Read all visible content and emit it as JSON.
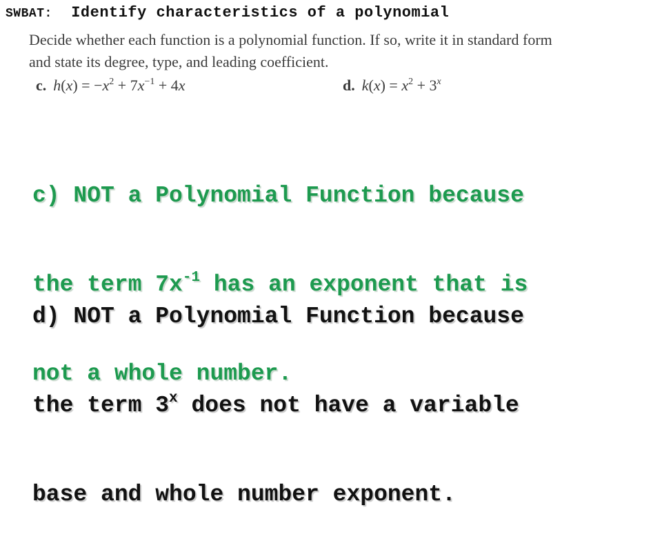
{
  "header": {
    "label": "SWBAT:",
    "objective": "Identify characteristics of a polynomial"
  },
  "problem": {
    "instruction_line1": "Decide whether each function is a polynomial function. If so, write it in standard form",
    "instruction_line2": "and state its degree, type, and leading coefficient.",
    "items": [
      {
        "letter": "c.",
        "fn": "h",
        "var": "x",
        "rhs_parts": [
          "−",
          "x",
          "2",
          " + 7",
          "x",
          "−1",
          " + 4",
          "x"
        ]
      },
      {
        "letter": "d.",
        "fn": "k",
        "var": "x",
        "rhs_parts": [
          "x",
          "2",
          " + 3",
          "x"
        ]
      }
    ]
  },
  "answers": {
    "c": {
      "line1": "c) NOT a Polynomial Function because",
      "line2_pre": "the term 7x",
      "line2_sup": "-1",
      "line2_post": " has an exponent that is",
      "line3": "not a whole number.",
      "color": "#1d9a4f"
    },
    "d": {
      "line1": "d) NOT a Polynomial Function because",
      "line2_pre": "the term 3",
      "line2_sup": "x",
      "line2_post": " does not have a variable",
      "line3": "base and whole number exponent.",
      "color": "#111111"
    }
  }
}
